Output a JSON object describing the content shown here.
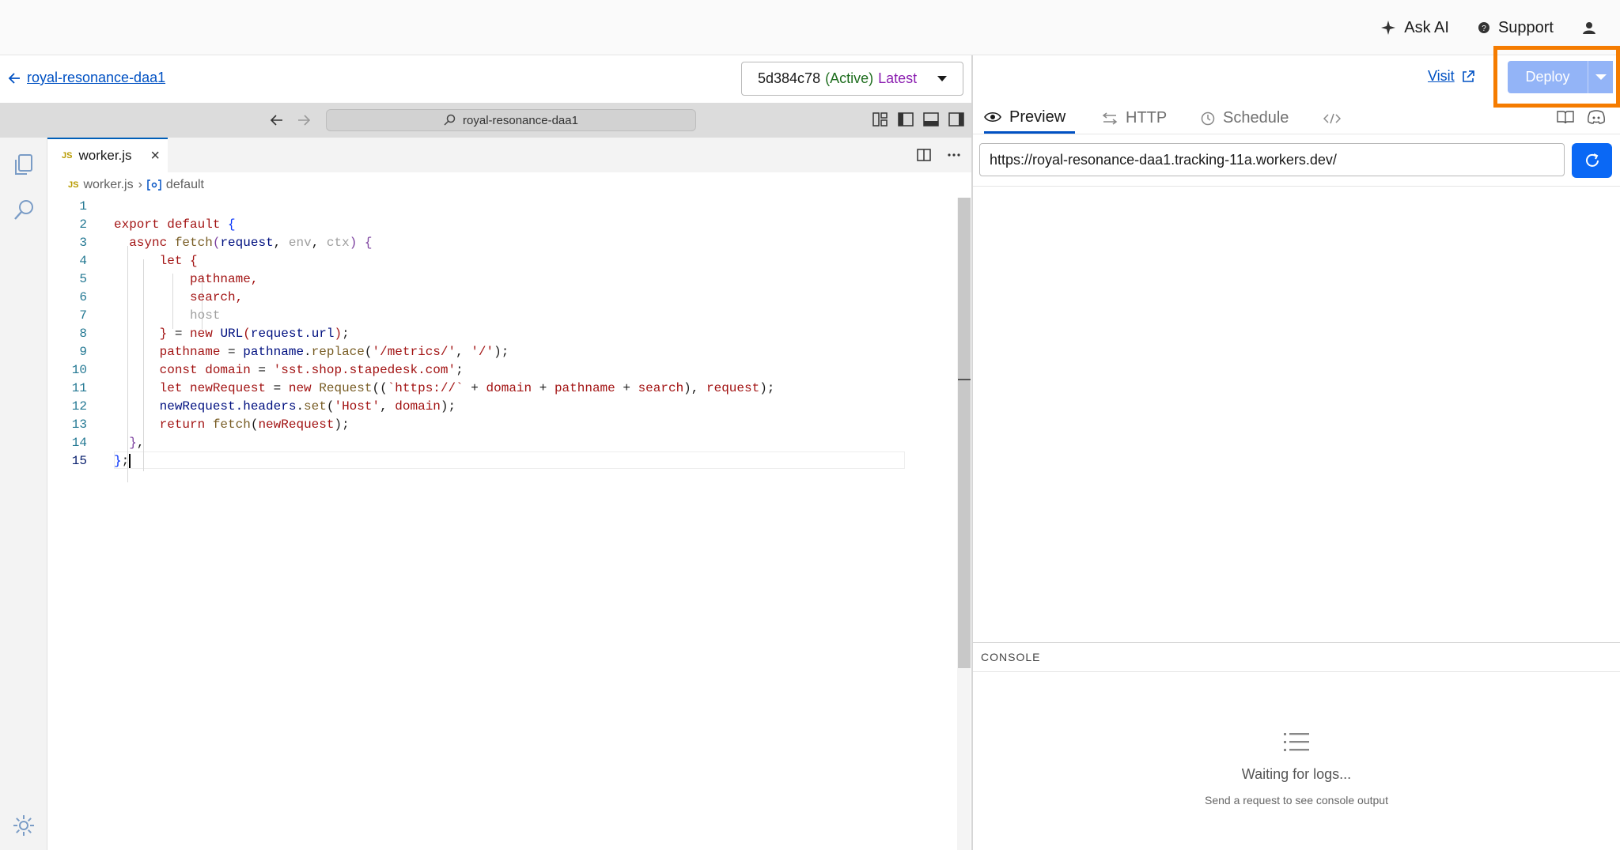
{
  "topbar": {
    "ask_ai": "Ask AI",
    "support": "Support"
  },
  "header": {
    "back_label": "royal-resonance-daa1",
    "version": {
      "id": "5d384c78",
      "status": "(Active)",
      "tag": "Latest"
    }
  },
  "editor": {
    "command_center": "royal-resonance-daa1",
    "tab": {
      "badge": "JS",
      "label": "worker.js"
    },
    "crumbs": {
      "file": "worker.js",
      "symbol": "default"
    },
    "line_numbers": [
      "1",
      "2",
      "3",
      "4",
      "5",
      "6",
      "7",
      "8",
      "9",
      "10",
      "11",
      "12",
      "13",
      "14",
      "15"
    ]
  },
  "right": {
    "visit": "Visit",
    "deploy": "Deploy",
    "tabs": {
      "preview": "Preview",
      "http": "HTTP",
      "schedule": "Schedule"
    },
    "url": "https://royal-resonance-daa1.tracking-11a.workers.dev/",
    "console": {
      "header": "CONSOLE",
      "waiting": "Waiting for logs...",
      "hint": "Send a request to see console output"
    }
  },
  "colors": {
    "link": "#0051c3",
    "deploy_disabled": "#93b4f7",
    "highlight": "#f57c00",
    "refresh": "#0a68f5"
  }
}
